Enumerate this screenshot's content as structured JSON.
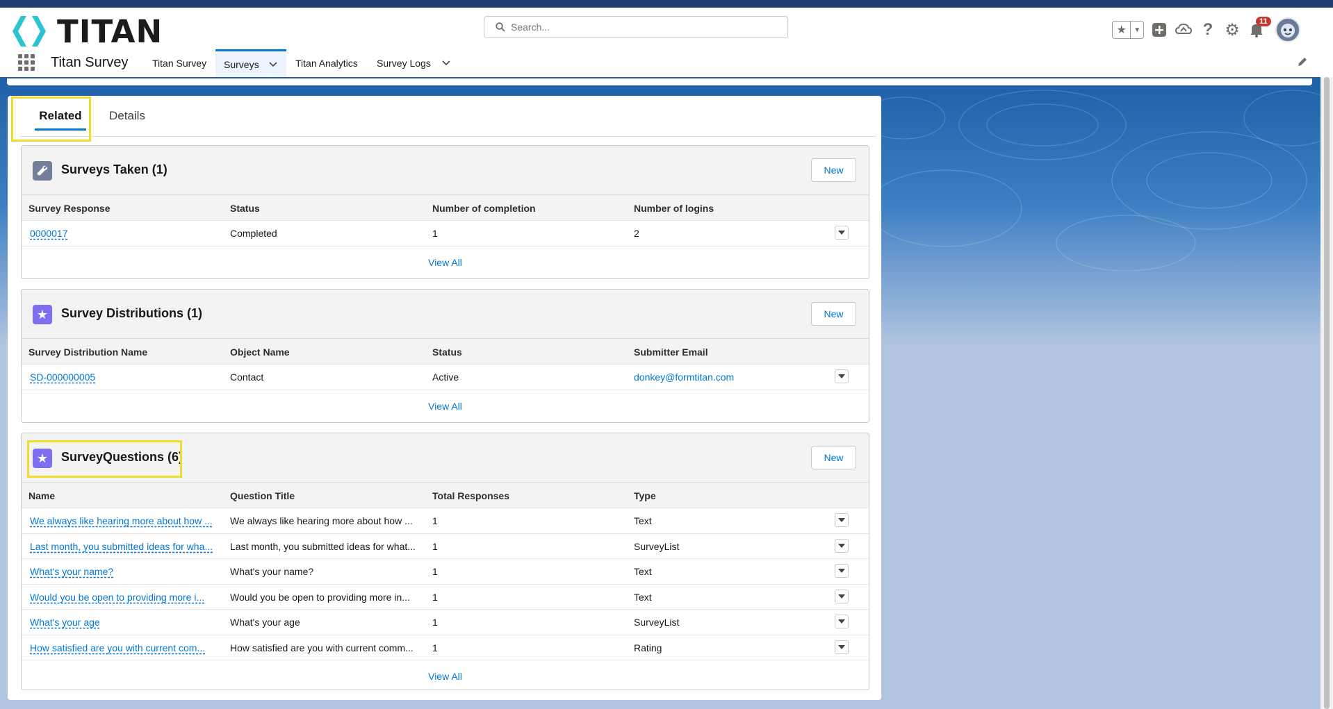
{
  "app": {
    "logo_text": "TITAN",
    "name": "Titan Survey",
    "search_placeholder": "Search...",
    "notification_count": "11"
  },
  "nav": {
    "tabs": [
      {
        "label": "Titan Survey",
        "active": false,
        "has_menu": false
      },
      {
        "label": "Surveys",
        "active": true,
        "has_menu": true
      },
      {
        "label": "Titan Analytics",
        "active": false,
        "has_menu": false
      },
      {
        "label": "Survey Logs",
        "active": false,
        "has_menu": true
      }
    ]
  },
  "record_tabs": {
    "related": "Related",
    "details": "Details"
  },
  "surveys_taken": {
    "title": "Surveys Taken (1)",
    "new_label": "New",
    "columns": [
      "Survey Response",
      "Status",
      "Number of completion",
      "Number of logins"
    ],
    "rows": [
      [
        "0000017",
        "Completed",
        "1",
        "2"
      ]
    ],
    "view_all": "View All"
  },
  "survey_distributions": {
    "title": "Survey Distributions (1)",
    "new_label": "New",
    "columns": [
      "Survey Distribution Name",
      "Object Name",
      "Status",
      "Submitter Email"
    ],
    "rows": [
      [
        "SD-000000005",
        "Contact",
        "Active",
        "donkey@formtitan.com"
      ]
    ],
    "view_all": "View All"
  },
  "survey_questions": {
    "title": "SurveyQuestions (6)",
    "new_label": "New",
    "columns": [
      "Name",
      "Question Title",
      "Total Responses",
      "Type"
    ],
    "rows": [
      [
        "We always like hearing more about how ...",
        "We always like hearing more about how ...",
        "1",
        "Text"
      ],
      [
        "Last month, you submitted ideas for wha...",
        "Last month, you submitted ideas for what...",
        "1",
        "SurveyList"
      ],
      [
        "What's your name?",
        "What's your name?",
        "1",
        "Text"
      ],
      [
        "Would you be open to providing more i...",
        "Would you be open to providing more in...",
        "1",
        "Text"
      ],
      [
        "What's your age",
        "What's your age",
        "1",
        "SurveyList"
      ],
      [
        "How satisfied are you with current com...",
        "How satisfied are you with current comm...",
        "1",
        "Rating"
      ]
    ],
    "view_all": "View All"
  },
  "colors": {
    "accent": "#0176d3",
    "highlight": "#eedc2f",
    "logo_teal": "#2bc4cf",
    "badge": "#c23934",
    "distribution_icon": "#7f6ff0",
    "surveys_taken_icon": "#747e9b"
  },
  "icons": {
    "search": "search-icon",
    "favorites": "star-icon",
    "add": "plus-icon",
    "trailhead": "cloud-icon",
    "help": "question-icon",
    "setup": "gear-icon",
    "notifications": "bell-icon",
    "edit_nav": "pencil-icon",
    "surveys_taken": "wrench-icon",
    "survey_distributions": "star-icon",
    "survey_questions": "star-icon",
    "row_actions": "chevron-down-icon"
  }
}
